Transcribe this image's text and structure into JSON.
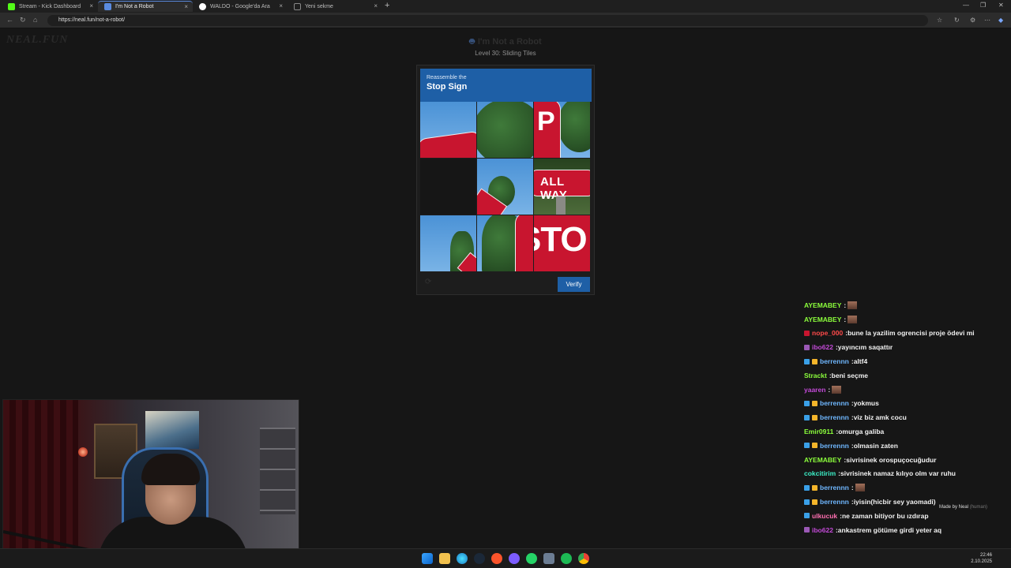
{
  "browser": {
    "tabs": [
      {
        "label": "Stream - Kick Dashboard",
        "favicon_color": "#53fc18"
      },
      {
        "label": "I'm Not a Robot",
        "favicon_color": "#5a8be0",
        "active": true
      },
      {
        "label": "WALDO - Google'da Ara",
        "favicon_color": "#ffffff"
      },
      {
        "label": "Yeni sekme",
        "favicon_color": "#888888"
      }
    ],
    "new_tab_symbol": "+",
    "close_symbol": "×",
    "url": "https://neal.fun/not-a-robot/"
  },
  "page": {
    "logo": "NEAL.FUN",
    "title": "I'm Not a Robot",
    "subtitle": "Level 30: Sliding Tiles"
  },
  "captcha": {
    "prompt_pre": "Reassemble the",
    "prompt_main": "Stop Sign",
    "tile_texts": {
      "p": "P",
      "allway": "ALL WAY",
      "stop": "STO"
    },
    "verify_label": "Verify",
    "refresh_symbol": "⟳"
  },
  "chat": {
    "messages": [
      {
        "user": "AYEMABEY",
        "color": "#8cff3c",
        "text": "",
        "emote": true,
        "badges": []
      },
      {
        "user": "AYEMABEY",
        "color": "#8cff3c",
        "text": "",
        "emote": true,
        "badges": []
      },
      {
        "user": "nope_000",
        "color": "#ff4a4a",
        "text": "bune la yazilim ogrencisi proje ödevi mi",
        "badges": [
          "#c8152f"
        ]
      },
      {
        "user": "ibo622",
        "color": "#c34ad8",
        "text": "yayıncım saqattır",
        "badges": [
          "#9b59b6"
        ]
      },
      {
        "user": "berrennn",
        "color": "#6fb7ff",
        "text": "altf4",
        "badges": [
          "#3aa0e8",
          "#f5b52a"
        ]
      },
      {
        "user": "Strackt",
        "color": "#8cff3c",
        "text": "beni seçme",
        "badges": []
      },
      {
        "user": "yaaren",
        "color": "#c34ad8",
        "text": "",
        "emote": true,
        "badges": []
      },
      {
        "user": "berrennn",
        "color": "#6fb7ff",
        "text": "yokmus",
        "badges": [
          "#3aa0e8",
          "#f5b52a"
        ]
      },
      {
        "user": "berrennn",
        "color": "#6fb7ff",
        "text": "viz biz amk cocu",
        "badges": [
          "#3aa0e8",
          "#f5b52a"
        ]
      },
      {
        "user": "Emir0911",
        "color": "#8cff3c",
        "text": "omurga galiba",
        "badges": []
      },
      {
        "user": "berrennn",
        "color": "#6fb7ff",
        "text": "olmasin zaten",
        "badges": [
          "#3aa0e8",
          "#f5b52a"
        ]
      },
      {
        "user": "AYEMABEY",
        "color": "#8cff3c",
        "text": "sivrisinek orospuçocuğudur",
        "badges": []
      },
      {
        "user": "cokcitirim",
        "color": "#3cf0c8",
        "text": "sivrisinek namaz kılıyo olm var ruhu",
        "badges": []
      },
      {
        "user": "berrennn",
        "color": "#6fb7ff",
        "text": "",
        "emote": true,
        "badges": [
          "#3aa0e8",
          "#f5b52a"
        ]
      },
      {
        "user": "berrennn",
        "color": "#6fb7ff",
        "text": "iyisin(hicbir sey yaomadi)",
        "badges": [
          "#3aa0e8",
          "#f5b52a"
        ]
      },
      {
        "user": "ulkucuk",
        "color": "#ff6fb0",
        "text": "ne zaman bitiyor bu ızdırap",
        "badges": [
          "#3aa0e8"
        ]
      },
      {
        "user": "ibo622",
        "color": "#c34ad8",
        "text": "ankastrem götüme girdi yeter aq",
        "badges": [
          "#9b59b6"
        ]
      }
    ]
  },
  "overlay": {
    "made_by": "Made by Neal",
    "made_by_tag": "(human)"
  },
  "taskbar": {
    "time": "22:46",
    "date": "2.10.2025",
    "apps": [
      "start-icon",
      "files-icon",
      "edge-icon",
      "steam-icon",
      "brave-icon",
      "discord-icon",
      "whatsapp-icon",
      "settings-icon",
      "spotify-icon",
      "chrome-icon"
    ]
  }
}
